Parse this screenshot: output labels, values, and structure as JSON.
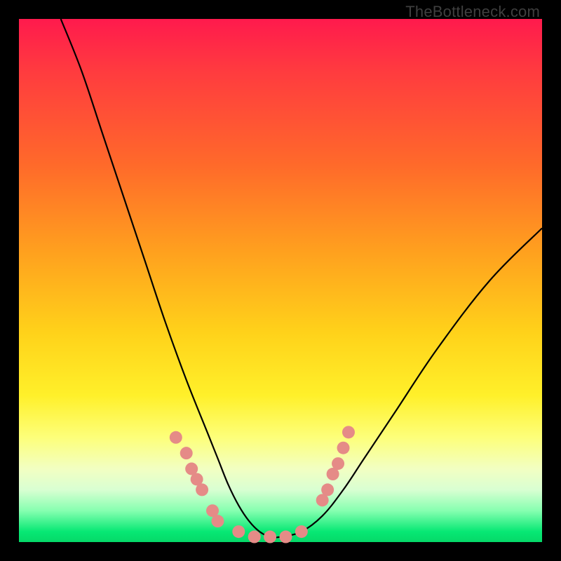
{
  "watermark": "TheBottleneck.com",
  "chart_data": {
    "type": "line",
    "title": "",
    "xlabel": "",
    "ylabel": "",
    "xlim": [
      0,
      100
    ],
    "ylim": [
      0,
      100
    ],
    "grid": false,
    "series": [
      {
        "name": "curve",
        "color": "#000000",
        "x": [
          8,
          12,
          16,
          20,
          24,
          28,
          32,
          36,
          38,
          40,
          42,
          44,
          46,
          48,
          50,
          54,
          58,
          62,
          66,
          72,
          80,
          90,
          100
        ],
        "y": [
          100,
          90,
          78,
          66,
          54,
          42,
          31,
          21,
          16,
          11,
          7,
          4,
          2,
          1,
          1,
          2,
          5,
          10,
          16,
          25,
          37,
          50,
          60
        ]
      }
    ],
    "markers": [
      {
        "name": "left-dots",
        "color": "#e58b87",
        "x": [
          30,
          32,
          33,
          34,
          35,
          37,
          38
        ],
        "y": [
          20,
          17,
          14,
          12,
          10,
          6,
          4
        ]
      },
      {
        "name": "bottom-dots",
        "color": "#e58b87",
        "x": [
          42,
          45,
          48,
          51,
          54
        ],
        "y": [
          2,
          1,
          1,
          1,
          2
        ]
      },
      {
        "name": "right-dots",
        "color": "#e58b87",
        "x": [
          58,
          59,
          60,
          61,
          62,
          63
        ],
        "y": [
          8,
          10,
          13,
          15,
          18,
          21
        ]
      }
    ]
  }
}
